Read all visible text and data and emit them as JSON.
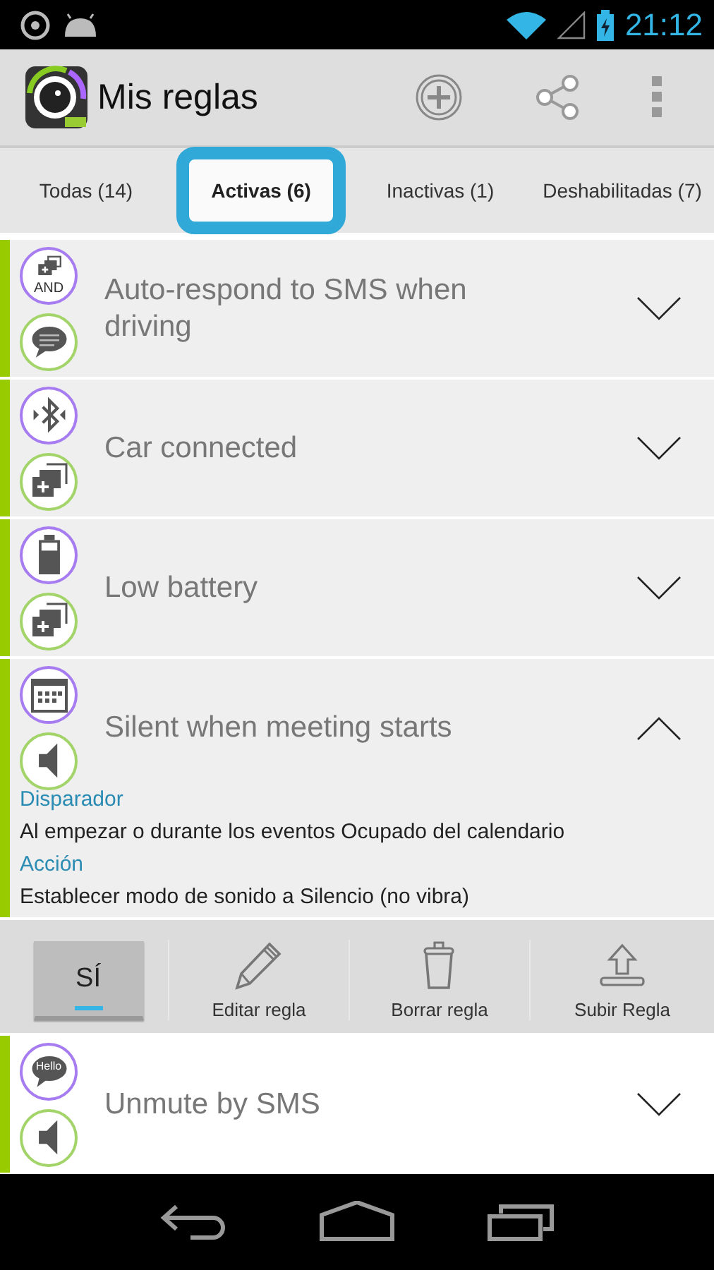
{
  "status_bar": {
    "time": "21:12"
  },
  "app_bar": {
    "title": "Mis reglas"
  },
  "tabs": [
    {
      "label": "Todas (14)",
      "selected": false
    },
    {
      "label": "Activas (6)",
      "selected": true
    },
    {
      "label": "Inactivas (1)",
      "selected": false
    },
    {
      "label": "Deshabilitadas (7)",
      "selected": false
    }
  ],
  "rules": [
    {
      "title": "Auto-respond to SMS when driving",
      "trigger": {
        "kind": "and",
        "label": "AND"
      },
      "action": {
        "kind": "message"
      },
      "expanded": false
    },
    {
      "title": "Car connected",
      "trigger": {
        "kind": "bluetooth"
      },
      "action": {
        "kind": "multi"
      },
      "expanded": false
    },
    {
      "title": "Low battery",
      "trigger": {
        "kind": "battery"
      },
      "action": {
        "kind": "multi"
      },
      "expanded": false
    },
    {
      "title": "Silent when meeting starts",
      "trigger": {
        "kind": "calendar"
      },
      "action": {
        "kind": "speaker"
      },
      "expanded": true,
      "details": {
        "trigger_heading": "Disparador",
        "trigger_text": "Al empezar o durante los eventos Ocupado del calendario",
        "action_heading": "Acción",
        "action_text": "Establecer modo de sonido a Silencio (no vibra)"
      },
      "toolbar": {
        "toggle": {
          "label": "SÍ",
          "on": true
        },
        "buttons": [
          {
            "kind": "edit",
            "label": "Editar regla"
          },
          {
            "kind": "delete",
            "label": "Borrar regla"
          },
          {
            "kind": "upload",
            "label": "Subir Regla"
          }
        ]
      }
    },
    {
      "title": "Unmute by SMS",
      "trigger": {
        "kind": "hello",
        "label": "Hello"
      },
      "action": {
        "kind": "speaker"
      },
      "expanded": false
    }
  ]
}
